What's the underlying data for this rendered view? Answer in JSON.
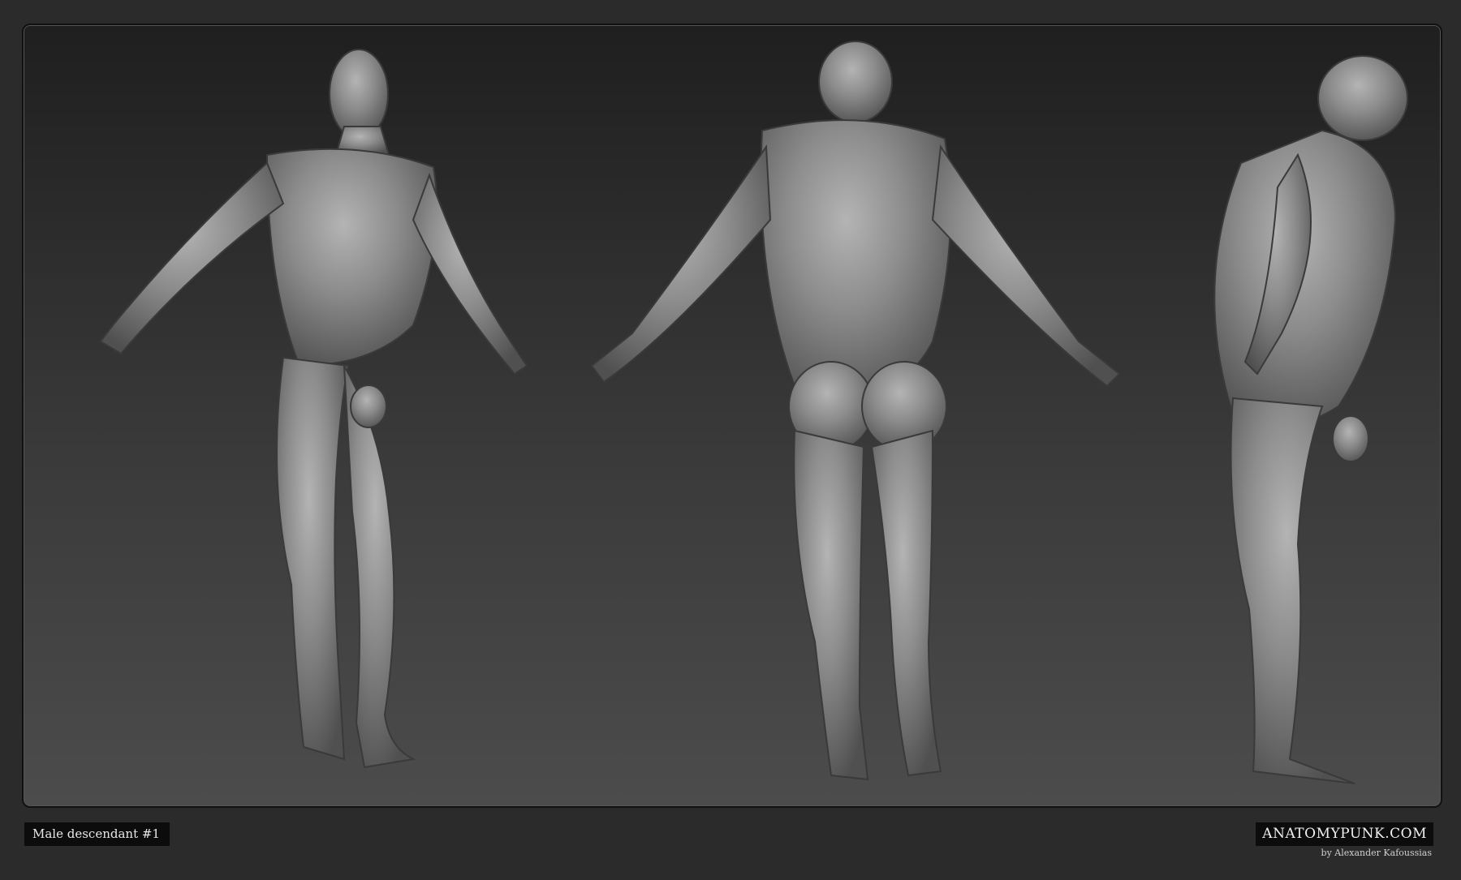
{
  "caption": "Male descendant #1",
  "brand": "ANATOMYPUNK.COM",
  "author": "by Alexander Kafoussias",
  "views": [
    {
      "name": "three-quarter-front-view"
    },
    {
      "name": "back-view"
    },
    {
      "name": "side-view"
    }
  ],
  "colors": {
    "page_bg": "#2b2b2b",
    "label_bg": "#0c0c0c",
    "sculpt": "#8a8a8a"
  }
}
